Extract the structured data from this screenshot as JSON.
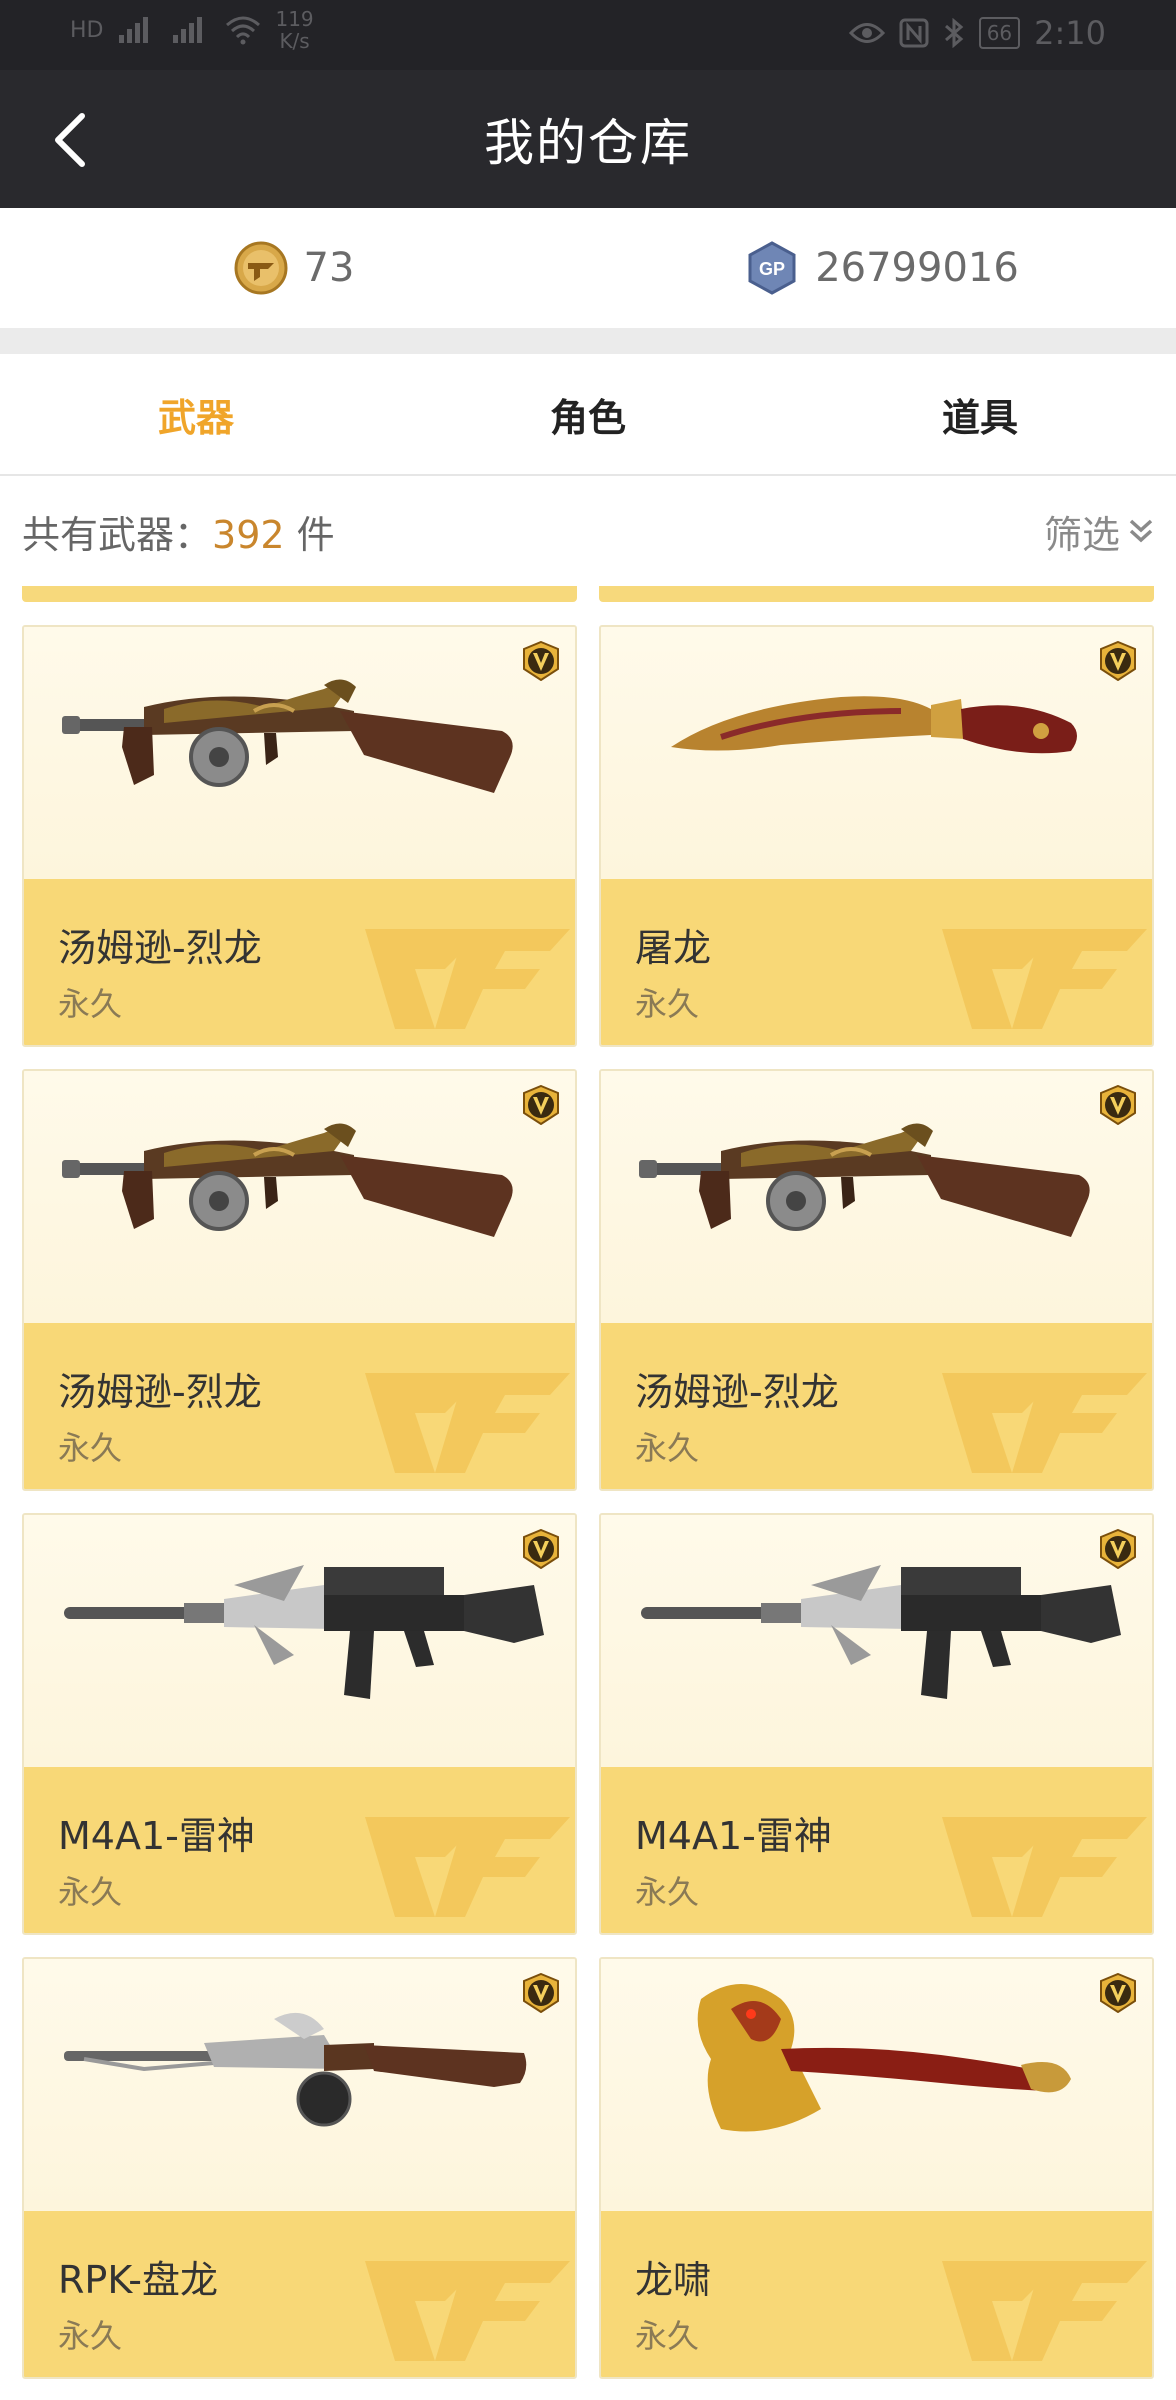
{
  "status_bar": {
    "signal_left": "HD",
    "net_speed_value": "119",
    "net_speed_unit": "K/s",
    "battery": "66",
    "time": "2:10"
  },
  "nav": {
    "title": "我的仓库",
    "back_icon": "chevron-left-icon"
  },
  "currency": {
    "cf_points": "73",
    "gp_points": "26799016",
    "cf_icon": "cf-coin-icon",
    "gp_icon": "gp-coin-icon"
  },
  "tabs": [
    {
      "label": "武器",
      "active": true
    },
    {
      "label": "角色",
      "active": false
    },
    {
      "label": "道具",
      "active": false
    }
  ],
  "summary": {
    "prefix": "共有武器：",
    "count": "392",
    "suffix": " 件",
    "filter_label": "筛选"
  },
  "items": [
    {
      "name": "汤姆逊-烈龙",
      "duration": "永久",
      "weapon": "thompson-dragon"
    },
    {
      "name": "屠龙",
      "duration": "永久",
      "weapon": "dragon-knife"
    },
    {
      "name": "汤姆逊-烈龙",
      "duration": "永久",
      "weapon": "thompson-dragon"
    },
    {
      "name": "汤姆逊-烈龙",
      "duration": "永久",
      "weapon": "thompson-dragon"
    },
    {
      "name": "M4A1-雷神",
      "duration": "永久",
      "weapon": "m4a1-thor"
    },
    {
      "name": "M4A1-雷神",
      "duration": "永久",
      "weapon": "m4a1-thor"
    },
    {
      "name": "RPK-盘龙",
      "duration": "永久",
      "weapon": "rpk-dragon"
    },
    {
      "name": "龙啸",
      "duration": "永久",
      "weapon": "dragon-axe"
    }
  ],
  "colors": {
    "accent": "#f0a52a",
    "nav_bg": "#29292d",
    "card_info_bg": "#f8d877",
    "count_color": "#c9862d"
  }
}
